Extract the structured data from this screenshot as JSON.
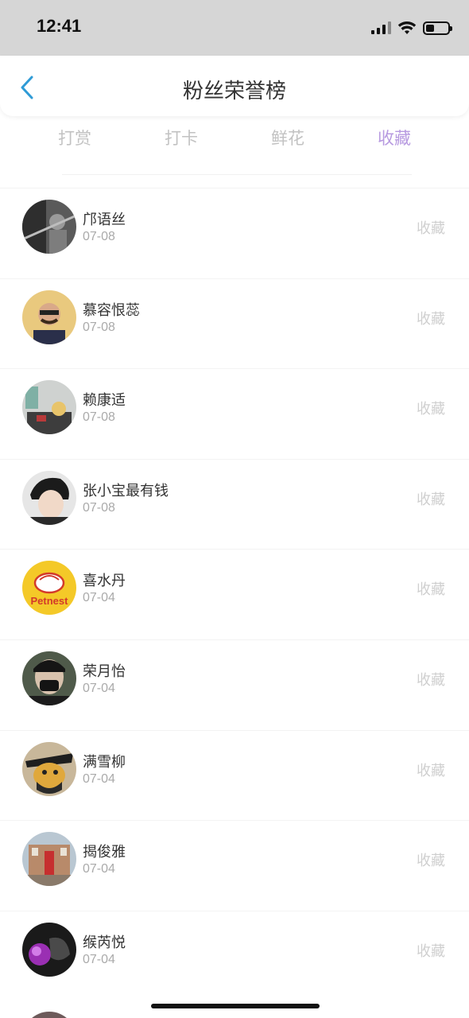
{
  "status_bar": {
    "time": "12:41"
  },
  "nav": {
    "title": "粉丝荣誉榜",
    "back_icon": "chevron-left-icon",
    "accent": "#2f9bd6"
  },
  "tabs": [
    {
      "label": "打赏",
      "active": false
    },
    {
      "label": "打卡",
      "active": false
    },
    {
      "label": "鲜花",
      "active": false
    },
    {
      "label": "收藏",
      "active": true
    }
  ],
  "active_tab_color": "#b79ae0",
  "fans": [
    {
      "name": "邝语丝",
      "date": "07-08",
      "action": "收藏"
    },
    {
      "name": "慕容恨蕊",
      "date": "07-08",
      "action": "收藏"
    },
    {
      "name": "赖康适",
      "date": "07-08",
      "action": "收藏"
    },
    {
      "name": "张小宝最有钱",
      "date": "07-08",
      "action": "收藏"
    },
    {
      "name": "喜水丹",
      "date": "07-04",
      "action": "收藏"
    },
    {
      "name": "荣月怡",
      "date": "07-04",
      "action": "收藏"
    },
    {
      "name": "满雪柳",
      "date": "07-04",
      "action": "收藏"
    },
    {
      "name": "揭俊雅",
      "date": "07-04",
      "action": "收藏"
    },
    {
      "name": "缑芮悦",
      "date": "07-04",
      "action": "收藏"
    }
  ],
  "avatar_logo_text": "Petnest"
}
